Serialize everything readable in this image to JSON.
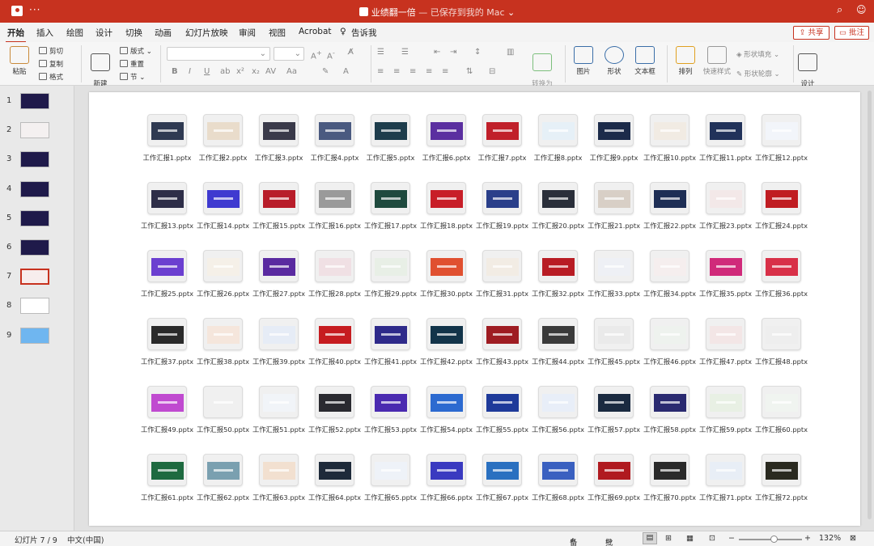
{
  "titlebar": {
    "doc_name": "业绩翻一倍",
    "status": " — 已保存到我的 Mac",
    "more": "···"
  },
  "tabs": [
    "开始",
    "插入",
    "绘图",
    "设计",
    "切换",
    "动画",
    "幻灯片放映",
    "审阅",
    "视图",
    "Acrobat",
    "告诉我"
  ],
  "actions": {
    "share": "共享",
    "comment": "批注"
  },
  "ribbon": {
    "paste": "粘贴",
    "cut": "剪切",
    "copy": "复制",
    "format": "格式",
    "new_slide": "新建\n幻灯片",
    "layout": "版式",
    "reset": "重置",
    "section": "节",
    "convert_smartart": "转换为\nSmartArt",
    "picture": "图片",
    "shape": "形状",
    "textbox": "文本框",
    "arrange": "排列",
    "quick_styles": "快速样式",
    "shape_fill": "形状填充",
    "shape_outline": "形状轮廓",
    "design_ideas": "设计\n灵感"
  },
  "slides": [
    {
      "num": "1",
      "color": "#1f1a4a"
    },
    {
      "num": "2",
      "color": "#f4f0f0"
    },
    {
      "num": "3",
      "color": "#1f1a4a"
    },
    {
      "num": "4",
      "color": "#1f1a4a"
    },
    {
      "num": "5",
      "color": "#1f1a4a"
    },
    {
      "num": "6",
      "color": "#1f1a4a"
    },
    {
      "num": "7",
      "color": "#f7eded"
    },
    {
      "num": "8",
      "color": "#ffffff"
    },
    {
      "num": "9",
      "color": "#6fb6f0"
    }
  ],
  "selected_slide": "7",
  "files": [
    {
      "name": "工作汇报1.pptx",
      "color": "#2f3a52"
    },
    {
      "name": "工作汇报2.pptx",
      "color": "#e9dccb"
    },
    {
      "name": "工作汇报3.pptx",
      "color": "#3a3a4a"
    },
    {
      "name": "工作汇报4.pptx",
      "color": "#4a5a80"
    },
    {
      "name": "工作汇报5.pptx",
      "color": "#1e3d4c"
    },
    {
      "name": "工作汇报6.pptx",
      "color": "#5b2fa0"
    },
    {
      "name": "工作汇报7.pptx",
      "color": "#c0202a"
    },
    {
      "name": "工作汇报8.pptx",
      "color": "#e6f0f7"
    },
    {
      "name": "工作汇报9.pptx",
      "color": "#1c2b4a"
    },
    {
      "name": "工作汇报10.pptx",
      "color": "#f1ebe3"
    },
    {
      "name": "工作汇报11.pptx",
      "color": "#21325a"
    },
    {
      "name": "工作汇报12.pptx",
      "color": "#f2f5fa"
    },
    {
      "name": "工作汇报13.pptx",
      "color": "#2e2e48"
    },
    {
      "name": "工作汇报14.pptx",
      "color": "#3f3ad0"
    },
    {
      "name": "工作汇报15.pptx",
      "color": "#b81d2a"
    },
    {
      "name": "工作汇报16.pptx",
      "color": "#9a9a9a"
    },
    {
      "name": "工作汇报17.pptx",
      "color": "#1f4a3e"
    },
    {
      "name": "工作汇报18.pptx",
      "color": "#c81e28"
    },
    {
      "name": "工作汇报19.pptx",
      "color": "#2a3f8a"
    },
    {
      "name": "工作汇报20.pptx",
      "color": "#2a2f3a"
    },
    {
      "name": "工作汇报21.pptx",
      "color": "#d8cfc6"
    },
    {
      "name": "工作汇报22.pptx",
      "color": "#1e2e55"
    },
    {
      "name": "工作汇报23.pptx",
      "color": "#f3e8e8"
    },
    {
      "name": "工作汇报24.pptx",
      "color": "#c01d22"
    },
    {
      "name": "工作汇报25.pptx",
      "color": "#6b3fd0"
    },
    {
      "name": "工作汇报26.pptx",
      "color": "#f5f0e8"
    },
    {
      "name": "工作汇报27.pptx",
      "color": "#5a2aa0"
    },
    {
      "name": "工作汇报28.pptx",
      "color": "#f0e0e4"
    },
    {
      "name": "工作汇报29.pptx",
      "color": "#e8efe6"
    },
    {
      "name": "工作汇报30.pptx",
      "color": "#e05030"
    },
    {
      "name": "工作汇报31.pptx",
      "color": "#f2ece4"
    },
    {
      "name": "工作汇报32.pptx",
      "color": "#b81c24"
    },
    {
      "name": "工作汇报33.pptx",
      "color": "#eef0f5"
    },
    {
      "name": "工作汇报34.pptx",
      "color": "#f5eeee"
    },
    {
      "name": "工作汇报35.pptx",
      "color": "#d02a7a"
    },
    {
      "name": "工作汇报36.pptx",
      "color": "#d83048"
    },
    {
      "name": "工作汇报37.pptx",
      "color": "#2a2a2a"
    },
    {
      "name": "工作汇报38.pptx",
      "color": "#f5e6dc"
    },
    {
      "name": "工作汇报39.pptx",
      "color": "#e6ecf6"
    },
    {
      "name": "工作汇报40.pptx",
      "color": "#c61c20"
    },
    {
      "name": "工作汇报41.pptx",
      "color": "#2e2a8a"
    },
    {
      "name": "工作汇报42.pptx",
      "color": "#12344a"
    },
    {
      "name": "工作汇报43.pptx",
      "color": "#9e1c22"
    },
    {
      "name": "工作汇报44.pptx",
      "color": "#3a3a3a"
    },
    {
      "name": "工作汇报45.pptx",
      "color": "#eaeaea"
    },
    {
      "name": "工作汇报46.pptx",
      "color": "#eef2ee"
    },
    {
      "name": "工作汇报47.pptx",
      "color": "#f3e6e6"
    },
    {
      "name": "工作汇报48.pptx",
      "color": "#eeeeee"
    },
    {
      "name": "工作汇报49.pptx",
      "color": "#c04ad0"
    },
    {
      "name": "工作汇报50.pptx",
      "color": "#f0f0f0"
    },
    {
      "name": "工作汇报51.pptx",
      "color": "#f1f4f8"
    },
    {
      "name": "工作汇报52.pptx",
      "color": "#2a2a30"
    },
    {
      "name": "工作汇报53.pptx",
      "color": "#4a2ab0"
    },
    {
      "name": "工作汇报54.pptx",
      "color": "#2c6ad0"
    },
    {
      "name": "工作汇报55.pptx",
      "color": "#1e3a9a"
    },
    {
      "name": "工作汇报56.pptx",
      "color": "#e8eef8"
    },
    {
      "name": "工作汇报57.pptx",
      "color": "#1a2a40"
    },
    {
      "name": "工作汇报58.pptx",
      "color": "#2a2a70"
    },
    {
      "name": "工作汇报59.pptx",
      "color": "#e8f0e4"
    },
    {
      "name": "工作汇报60.pptx",
      "color": "#f0f4f0"
    },
    {
      "name": "工作汇报61.pptx",
      "color": "#1e6a40"
    },
    {
      "name": "工作汇报62.pptx",
      "color": "#7aa0b0"
    },
    {
      "name": "工作汇报63.pptx",
      "color": "#f2e0d0"
    },
    {
      "name": "工作汇报64.pptx",
      "color": "#1e2a3a"
    },
    {
      "name": "工作汇报65.pptx",
      "color": "#eef2f8"
    },
    {
      "name": "工作汇报66.pptx",
      "color": "#3a3ac0"
    },
    {
      "name": "工作汇报67.pptx",
      "color": "#2a70c0"
    },
    {
      "name": "工作汇报68.pptx",
      "color": "#3a60c0"
    },
    {
      "name": "工作汇报69.pptx",
      "color": "#b01a20"
    },
    {
      "name": "工作汇报70.pptx",
      "color": "#2a2a2a"
    },
    {
      "name": "工作汇报71.pptx",
      "color": "#e8eef6"
    },
    {
      "name": "工作汇报72.pptx",
      "color": "#2a2a20"
    }
  ],
  "statusbar": {
    "slide_info": "幻灯片 7 / 9",
    "language": "中文(中国)",
    "notes": "备注",
    "comments": "批注",
    "zoom": "132%"
  }
}
